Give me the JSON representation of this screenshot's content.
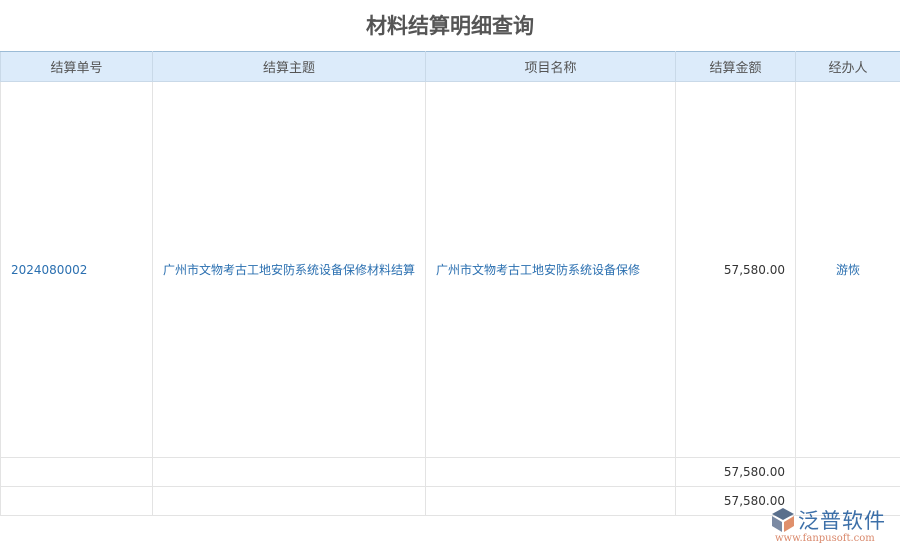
{
  "title": "材料结算明细查询",
  "columns": [
    "结算单号",
    "结算主题",
    "项目名称",
    "结算金额",
    "经办人"
  ],
  "rows": [
    {
      "no": "2024080002",
      "subject": "广州市文物考古工地安防系统设备保修材料结算",
      "project": "广州市文物考古工地安防系统设备保修",
      "amount": "57,580.00",
      "handler": "游恢"
    }
  ],
  "subtotal": "57,580.00",
  "total": "57,580.00",
  "logo": {
    "name": "泛普软件",
    "url": "www.fanpusoft.com"
  }
}
